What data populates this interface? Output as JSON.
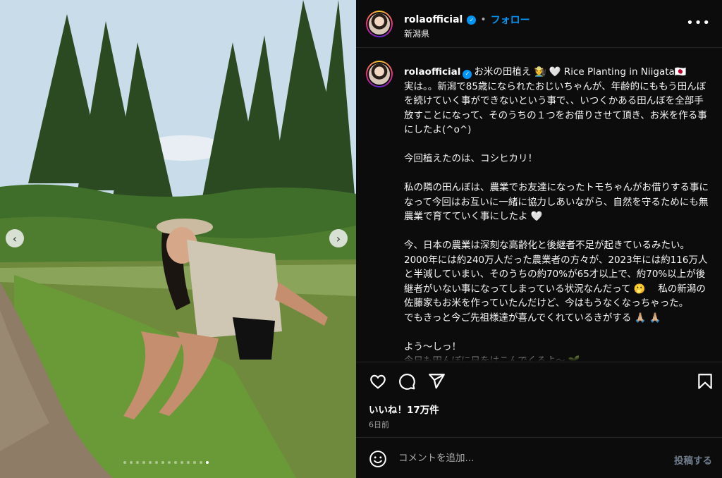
{
  "photo": {
    "prev_icon": "chevron-left-icon",
    "next_icon": "chevron-right-icon",
    "slides_count": 14,
    "active_slide": 13
  },
  "header": {
    "username": "rolaofficial",
    "separator": "•",
    "follow_label": "フォロー",
    "location": "新潟県",
    "more_label": "•••"
  },
  "caption": {
    "username": "rolaofficial",
    "title": "お米の田植え 🧑‍🌾 🤍 Rice Planting in Niigata🇯🇵",
    "body": "実は。。新潟で85歳になられたおじいちゃんが、年齢的にももう田んぼを続けていく事ができないという事で、、いつくかある田んぼを全部手放すことになって、そのうちの１つをお借りさせて頂き、お米を作る事にしたよ(^o^)\n\n今回植えたのは、コシヒカリ！\n\n私の隣の田んぼは、農業でお友達になったトモちゃんがお借りする事になって今回はお互いに一緒に協力しあいながら、自然を守るためにも無農業で育てていく事にしたよ 🤍\n\n今、日本の農業は深刻な高齢化と後継者不足が起きているみたい。\n2000年には約240万人だった農業者の方々が、2023年には約116万人と半減していまい、そのうちの約70%が65才以上で、約70%以上が後継者がいない事になってしまっている状況なんだって 🫢 　私の新潟の佐藤家もお米を作っていたんだけど、今はもうなくなっちゃった。\nでもきっと今ご先祖様達が喜んでくれているきがする 🙏🏼 🙏🏼\n\nよう〜しっ！\n今日も田んぼに日をはこんでくるよ〜 🌱"
  },
  "actions": {
    "like_icon": "heart-icon",
    "comment_icon": "comment-icon",
    "share_icon": "share-icon",
    "save_icon": "bookmark-icon"
  },
  "likes_label": "いいね！17万件",
  "time_label": "6日前",
  "comment": {
    "emoji_icon": "emoji-icon",
    "placeholder": "コメントを追加...",
    "post_label": "投稿する"
  },
  "colors": {
    "accent": "#0095f6",
    "background": "#0c0c0c",
    "divider": "#262626",
    "muted": "#a8a8a8"
  }
}
